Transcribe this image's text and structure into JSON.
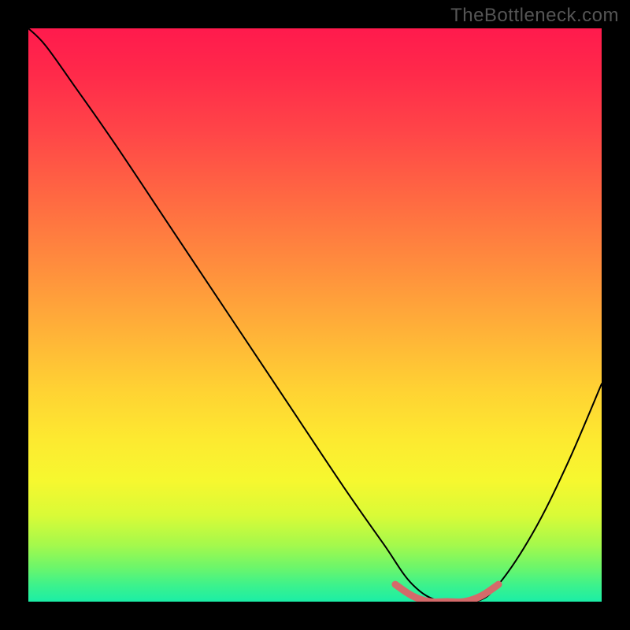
{
  "watermark": "TheBottleneck.com",
  "chart_data": {
    "type": "line",
    "title": "",
    "xlabel": "",
    "ylabel": "",
    "xlim": [
      0,
      100
    ],
    "ylim": [
      0,
      100
    ],
    "grid": false,
    "legend": false,
    "background_gradient": {
      "orientation": "vertical",
      "stops": [
        {
          "pos": 0.0,
          "color": "#ff1a4d"
        },
        {
          "pos": 0.18,
          "color": "#ff4548"
        },
        {
          "pos": 0.42,
          "color": "#ff8f3d"
        },
        {
          "pos": 0.63,
          "color": "#ffd233"
        },
        {
          "pos": 0.79,
          "color": "#f6f82f"
        },
        {
          "pos": 0.9,
          "color": "#a6f94b"
        },
        {
          "pos": 1.0,
          "color": "#1beea6"
        }
      ]
    },
    "annotations": [
      {
        "text": "TheBottleneck.com",
        "position": "top-right",
        "color": "#555555"
      }
    ],
    "series": [
      {
        "name": "bottleneck-curve",
        "color": "#000000",
        "stroke_width": 2,
        "x": [
          0,
          3,
          8,
          15,
          25,
          35,
          45,
          55,
          62,
          67,
          72,
          78,
          82,
          88,
          94,
          100
        ],
        "values": [
          100,
          97,
          90,
          80,
          65,
          50,
          35,
          20,
          10,
          3,
          0,
          0,
          3,
          12,
          24,
          38
        ]
      },
      {
        "name": "optimal-band",
        "color": "#d46a6a",
        "stroke_width": 9,
        "x": [
          64,
          67,
          70,
          73,
          76,
          79,
          82
        ],
        "values": [
          3,
          1,
          0,
          0,
          0,
          1,
          3
        ]
      }
    ]
  }
}
